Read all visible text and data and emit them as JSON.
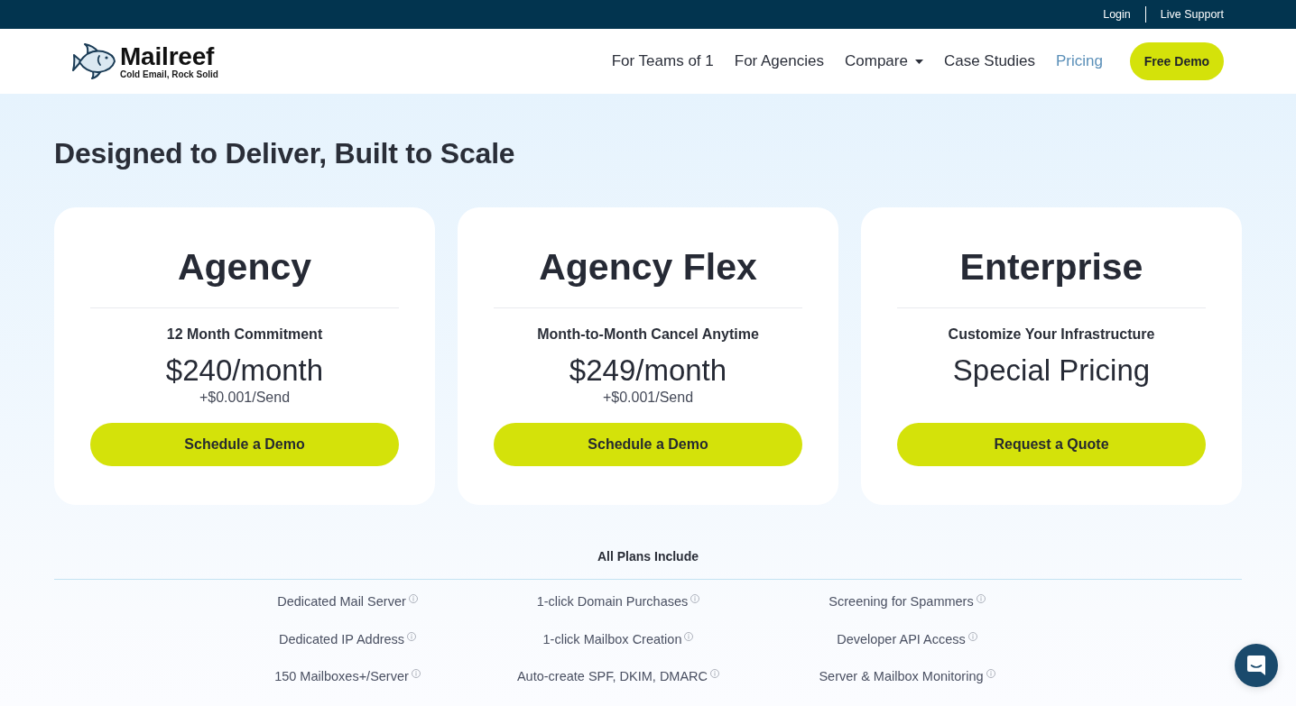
{
  "top_bar": {
    "links": [
      "Login",
      "Live Support"
    ]
  },
  "header": {
    "logo": {
      "name": "Mailreef",
      "tagline": "Cold Email, Rock Solid"
    },
    "nav": [
      {
        "label": "For Teams of 1",
        "kind": "link",
        "selected": false
      },
      {
        "label": "For Agencies",
        "kind": "link",
        "selected": false
      },
      {
        "label": "Compare",
        "kind": "dropdown",
        "selected": false
      },
      {
        "label": "Case Studies",
        "kind": "link",
        "selected": false
      },
      {
        "label": "Pricing",
        "kind": "link",
        "selected": true
      }
    ],
    "cta": "Free Demo"
  },
  "heading": "Designed to Deliver, Built to Scale",
  "plans": [
    {
      "name": "Agency",
      "term": "12 Month Commitment",
      "price": "$240/month",
      "per_send": "+$0.001/Send",
      "button": "Schedule a Demo"
    },
    {
      "name": "Agency Flex",
      "term": "Month-to-Month Cancel Anytime",
      "price": "$249/month",
      "per_send": "+$0.001/Send",
      "button": "Schedule a Demo"
    },
    {
      "name": "Enterprise",
      "term": "Customize Your Infrastructure",
      "price": "Special Pricing",
      "button": "Request a Quote"
    }
  ],
  "features": {
    "title": "All Plans Include",
    "columns": [
      [
        {
          "label": "Dedicated Mail Server",
          "info": true
        },
        {
          "label": "Dedicated IP Address",
          "info": true
        },
        {
          "label": "150 Mailboxes+/Server",
          "info": true
        }
      ],
      [
        {
          "label": "1-click Domain Purchases",
          "info": true
        },
        {
          "label": "1-click Mailbox Creation",
          "info": true
        },
        {
          "label": "Auto-create SPF, DKIM, DMARC",
          "info": true
        }
      ],
      [
        {
          "label": "Screening for Spammers",
          "info": true
        },
        {
          "label": "Developer API Access",
          "info": true
        },
        {
          "label": "Server & Mailbox Monitoring",
          "info": true
        }
      ]
    ]
  }
}
